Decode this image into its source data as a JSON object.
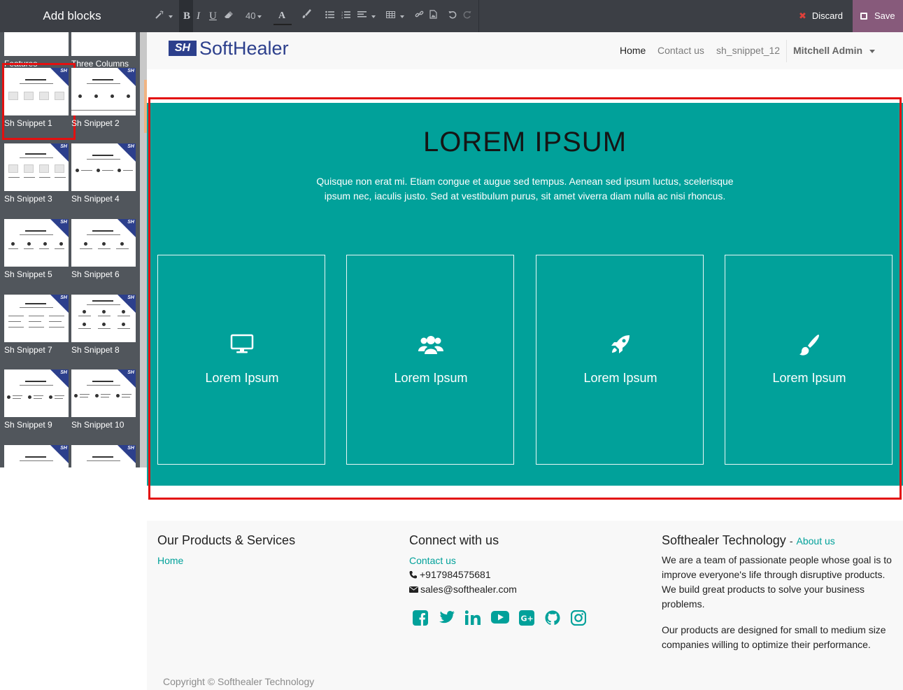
{
  "sidebar": {
    "title": "Add blocks",
    "top_labels": [
      "Features",
      "Three Columns"
    ],
    "blocks": [
      {
        "label": "Sh Snippet 1"
      },
      {
        "label": "Sh Snippet 2"
      },
      {
        "label": "Sh Snippet 3"
      },
      {
        "label": "Sh Snippet 4"
      },
      {
        "label": "Sh Snippet 5"
      },
      {
        "label": "Sh Snippet 6"
      },
      {
        "label": "Sh Snippet 7"
      },
      {
        "label": "Sh Snippet 8"
      },
      {
        "label": "Sh Snippet 9"
      },
      {
        "label": "Sh Snippet 10"
      }
    ],
    "badge_text": "SH"
  },
  "toolbar": {
    "bold": "B",
    "italic": "I",
    "underline": "U",
    "font_size": "40",
    "font_color": "A",
    "discard_label": "Discard",
    "save_label": "Save"
  },
  "header": {
    "logo_mark": "SH",
    "logo_name": "SoftHealer",
    "nav": [
      "Home",
      "Contact us",
      "sh_snippet_12"
    ],
    "user": "Mitchell Admin"
  },
  "snippet": {
    "title": "LOREM IPSUM",
    "description": "Quisque non erat mi. Etiam congue et augue sed tempus. Aenean sed ipsum luctus, scelerisque ipsum nec, iaculis justo. Sed at vestibulum purus, sit amet viverra diam nulla ac nisi rhoncus.",
    "cards": [
      {
        "icon": "desktop-icon",
        "title": "Lorem Ipsum"
      },
      {
        "icon": "users-icon",
        "title": "Lorem Ipsum"
      },
      {
        "icon": "rocket-icon",
        "title": "Lorem Ipsum"
      },
      {
        "icon": "paint-brush-icon",
        "title": "Lorem Ipsum"
      }
    ]
  },
  "footer": {
    "products_title": "Our Products & Services",
    "products_links": [
      "Home"
    ],
    "connect_title": "Connect with us",
    "contact_link": "Contact us",
    "phone": "+917984575681",
    "email": "sales@softhealer.com",
    "social_icons": [
      "facebook-icon",
      "twitter-icon",
      "linkedin-icon",
      "youtube-icon",
      "google-plus-icon",
      "github-icon",
      "instagram-icon"
    ],
    "company_title": "Softhealer Technology",
    "company_sep": "-",
    "about_link": "About us",
    "about_p1": "We are a team of passionate people whose goal is to improve everyone's life through disruptive products. We build great products to solve your business problems.",
    "about_p2": "Our products are designed for small to medium size companies willing to optimize their performance.",
    "copyright": "Copyright © Softhealer Technology"
  },
  "colors": {
    "accent": "#01a19a",
    "save": "#875a7b",
    "brand": "#2c3f8c",
    "selection": "#e31010"
  }
}
